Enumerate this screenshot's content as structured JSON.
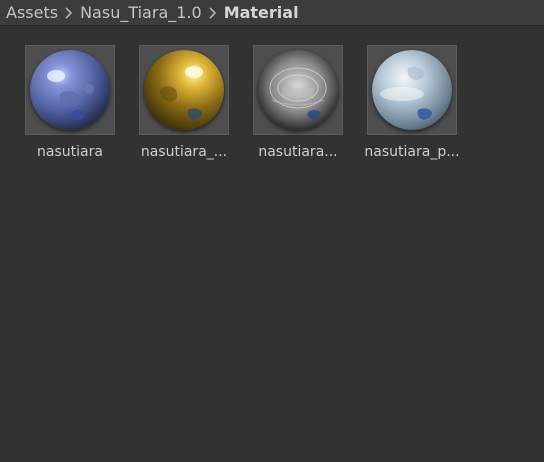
{
  "breadcrumb": {
    "items": [
      "Assets",
      "Nasu_Tiara_1.0",
      "Material"
    ]
  },
  "materials": [
    {
      "label": "nasutiara",
      "icon": "material-sphere-blue-icon"
    },
    {
      "label": "nasutiara_...",
      "icon": "material-sphere-gold-icon"
    },
    {
      "label": "nasutiara...",
      "icon": "material-sphere-chrome-icon"
    },
    {
      "label": "nasutiara_p...",
      "icon": "material-sphere-pearl-icon"
    }
  ]
}
